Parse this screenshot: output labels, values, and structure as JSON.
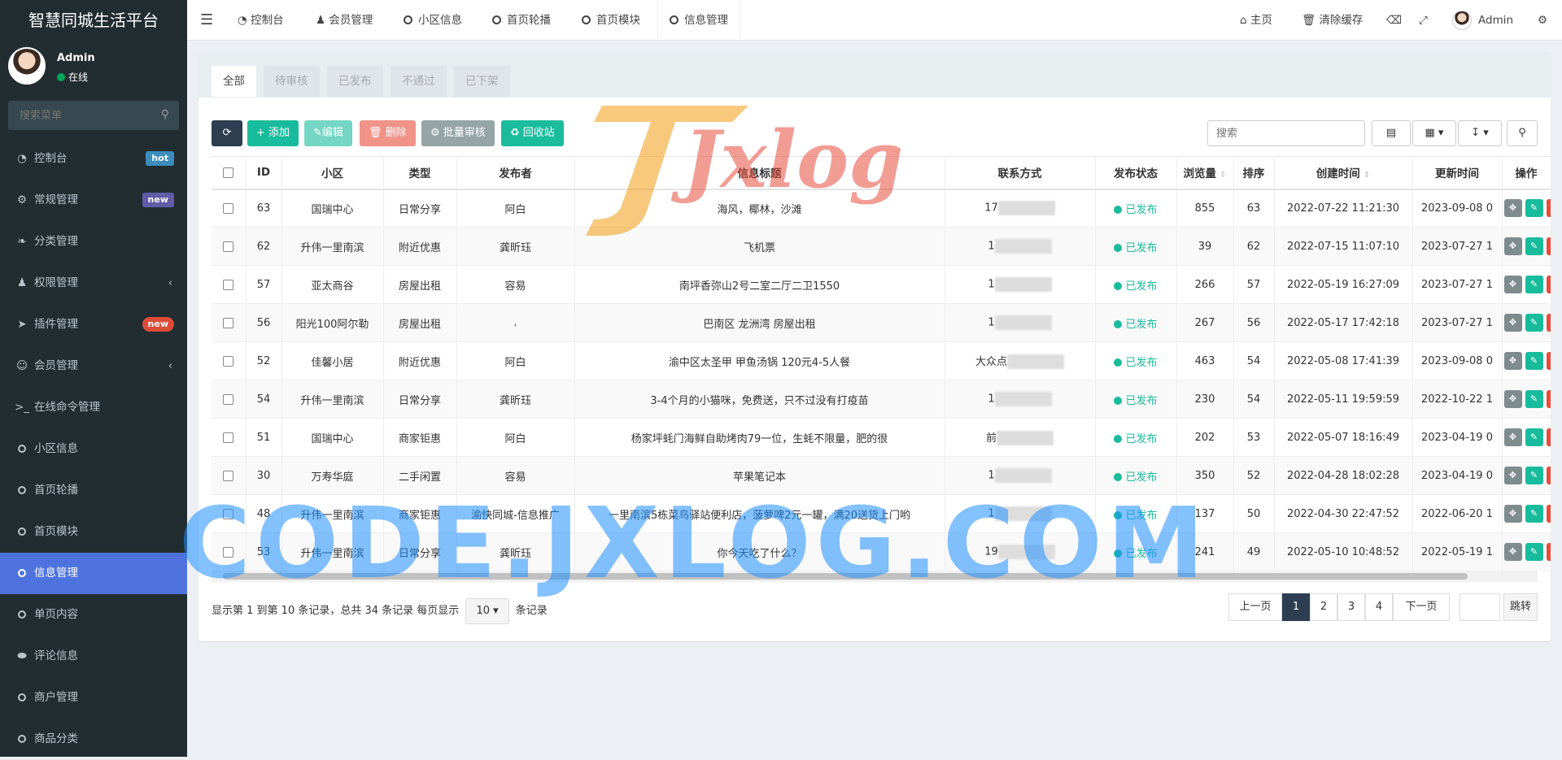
{
  "app": {
    "title": "智慧同城生活平台"
  },
  "user": {
    "name": "Admin",
    "status": "在线"
  },
  "sidebar": {
    "search_placeholder": "搜索菜单",
    "items": [
      {
        "label": "控制台",
        "icon": "dashboard-icon",
        "badge": "hot"
      },
      {
        "label": "常规管理",
        "icon": "cogs-icon",
        "badge": "new"
      },
      {
        "label": "分类管理",
        "icon": "leaf-icon"
      },
      {
        "label": "权限管理",
        "icon": "group-icon",
        "caret": "‹"
      },
      {
        "label": "插件管理",
        "icon": "rocket-icon",
        "badge": "new"
      },
      {
        "label": "会员管理",
        "icon": "user-circle-icon",
        "caret": "‹"
      },
      {
        "label": "在线命令管理",
        "icon": "terminal-icon"
      },
      {
        "label": "小区信息",
        "icon": "circle-icon"
      },
      {
        "label": "首页轮播",
        "icon": "circle-icon"
      },
      {
        "label": "首页模块",
        "icon": "circle-icon"
      },
      {
        "label": "信息管理",
        "icon": "circle-icon",
        "active": true
      },
      {
        "label": "单页内容",
        "icon": "circle-icon"
      },
      {
        "label": "评论信息",
        "icon": "comment-icon"
      },
      {
        "label": "商户管理",
        "icon": "circle-icon"
      },
      {
        "label": "商品分类",
        "icon": "circle-icon"
      }
    ]
  },
  "topbar": {
    "tabs": [
      "控制台",
      "会员管理",
      "小区信息",
      "首页轮播",
      "首页模块",
      "信息管理"
    ],
    "home": "主页",
    "clear_cache": "清除缓存",
    "admin": "Admin"
  },
  "filter_tabs": [
    "全部",
    "待审核",
    "已发布",
    "不通过",
    "已下架"
  ],
  "toolbar": {
    "add": "添加",
    "edit": "编辑",
    "delete": "删除",
    "batch": "批量审核",
    "recycle": "回收站",
    "search_placeholder": "搜索"
  },
  "table": {
    "headers": [
      "ID",
      "小区",
      "类型",
      "发布者",
      "信息标题",
      "联系方式",
      "发布状态",
      "浏览量",
      "排序",
      "创建时间",
      "更新时间",
      "操作"
    ],
    "rows": [
      {
        "id": "63",
        "community": "国瑞中心",
        "type": "日常分享",
        "publisher": "阿白",
        "title": "海风，椰林，沙滩",
        "contact": "17",
        "status": "已发布",
        "views": "855",
        "sort": "63",
        "created": "2022-07-22 11:21:30",
        "updated": "2023-09-08 0"
      },
      {
        "id": "62",
        "community": "升伟一里南滨",
        "type": "附近优惠",
        "publisher": "龚昕珏",
        "title": "飞机票",
        "contact": "1",
        "status": "已发布",
        "views": "39",
        "sort": "62",
        "created": "2022-07-15 11:07:10",
        "updated": "2023-07-27 1"
      },
      {
        "id": "57",
        "community": "亚太商谷",
        "type": "房屋出租",
        "publisher": "容易",
        "title": "南坪香弥山2号二室二厅二卫1550",
        "contact": "1",
        "status": "已发布",
        "views": "266",
        "sort": "57",
        "created": "2022-05-19 16:27:09",
        "updated": "2023-07-27 1"
      },
      {
        "id": "56",
        "community": "阳光100阿尔勒",
        "type": "房屋出租",
        "publisher": ".",
        "title": "巴南区 龙洲湾 房屋出租",
        "contact": "1",
        "status": "已发布",
        "views": "267",
        "sort": "56",
        "created": "2022-05-17 17:42:18",
        "updated": "2023-07-27 1"
      },
      {
        "id": "52",
        "community": "佳馨小居",
        "type": "附近优惠",
        "publisher": "阿白",
        "title": "渝中区太圣甲 甲鱼汤锅 120元4-5人餐",
        "contact": "大众点",
        "status": "已发布",
        "views": "463",
        "sort": "54",
        "created": "2022-05-08 17:41:39",
        "updated": "2023-09-08 0"
      },
      {
        "id": "54",
        "community": "升伟一里南滨",
        "type": "日常分享",
        "publisher": "龚昕珏",
        "title": "3-4个月的小猫咪，免费送，只不过没有打疫苗",
        "contact": "1",
        "status": "已发布",
        "views": "230",
        "sort": "54",
        "created": "2022-05-11 19:59:59",
        "updated": "2022-10-22 1"
      },
      {
        "id": "51",
        "community": "国瑞中心",
        "type": "商家钜惠",
        "publisher": "阿白",
        "title": "杨家坪蚝门海鲜自助烤肉79一位，生蚝不限量，肥的很",
        "contact": "前",
        "status": "已发布",
        "views": "202",
        "sort": "53",
        "created": "2022-05-07 18:16:49",
        "updated": "2023-04-19 0"
      },
      {
        "id": "30",
        "community": "万寿华庭",
        "type": "二手闲置",
        "publisher": "容易",
        "title": "苹果笔记本",
        "contact": "1",
        "status": "已发布",
        "views": "350",
        "sort": "52",
        "created": "2022-04-28 18:02:28",
        "updated": "2023-04-19 0"
      },
      {
        "id": "48",
        "community": "升伟一里南滨",
        "type": "商家钜惠",
        "publisher": "渝快同城-信息推广",
        "title": "一里南滨5栋菜鸟驿站便利店，菠萝啤2元一罐，满20送货上门哟",
        "contact": "1",
        "status": "已发布",
        "views": "137",
        "sort": "50",
        "created": "2022-04-30 22:47:52",
        "updated": "2022-06-20 1"
      },
      {
        "id": "53",
        "community": "升伟一里南滨",
        "type": "日常分享",
        "publisher": "龚昕珏",
        "title": "你今天吃了什么？",
        "contact": "19",
        "status": "已发布",
        "views": "241",
        "sort": "49",
        "created": "2022-05-10 10:48:52",
        "updated": "2022-05-19 1"
      }
    ]
  },
  "pager": {
    "info_prefix": "显示第 1 到第 10 条记录，总共 34 条记录 每页显示",
    "page_size": "10",
    "info_suffix": "条记录",
    "prev": "上一页",
    "next": "下一页",
    "pages": [
      "1",
      "2",
      "3",
      "4"
    ],
    "jump": "跳转"
  },
  "watermarks": {
    "logo": "Jxlog",
    "url": "CODE.JXLOG.COM"
  },
  "colors": {
    "sidebar": "#222d32",
    "active": "#4e73df",
    "success": "#18bc9c",
    "danger": "#e74c3c"
  }
}
